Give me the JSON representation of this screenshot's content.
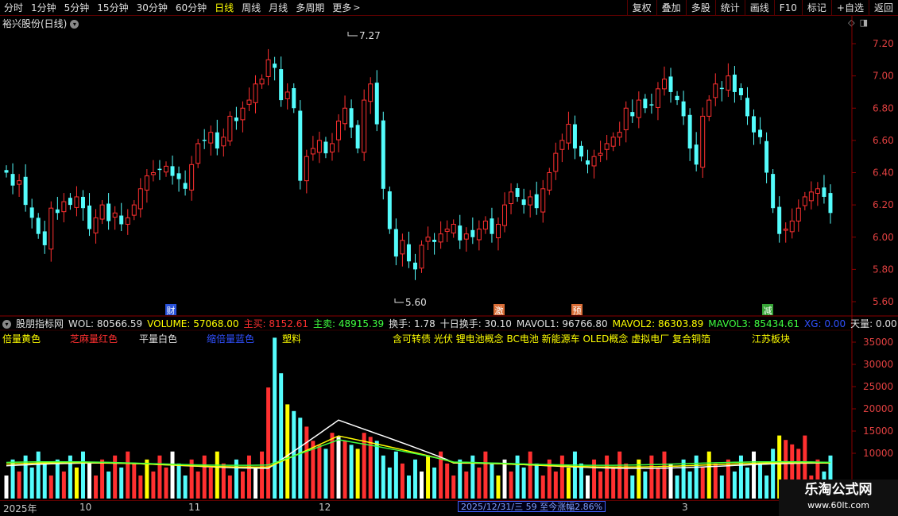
{
  "toolbar": {
    "periods": [
      {
        "label": "分时",
        "active": false
      },
      {
        "label": "1分钟",
        "active": false
      },
      {
        "label": "5分钟",
        "active": false
      },
      {
        "label": "15分钟",
        "active": false
      },
      {
        "label": "30分钟",
        "active": false
      },
      {
        "label": "60分钟",
        "active": false
      },
      {
        "label": "日线",
        "active": true
      },
      {
        "label": "周线",
        "active": false
      },
      {
        "label": "月线",
        "active": false
      },
      {
        "label": "多周期",
        "active": false
      },
      {
        "label": "更多",
        "active": false
      }
    ],
    "more_chevron": "chevron-right-icon",
    "right_buttons": [
      "复权",
      "叠加",
      "多股",
      "统计",
      "画线",
      "F10",
      "标记",
      "+自选",
      "返回"
    ]
  },
  "stock": {
    "title": "裕兴股份(日线)"
  },
  "price_axis": {
    "ticks": [
      "7.20",
      "7.00",
      "6.80",
      "6.60",
      "6.40",
      "6.20",
      "6.00",
      "5.80",
      "5.60"
    ],
    "high_label": "7.27",
    "low_label": "5.60"
  },
  "event_markers": [
    {
      "label": "财",
      "color": "#3060ff"
    },
    {
      "label": "激",
      "color": "#ff8040"
    },
    {
      "label": "预",
      "color": "#ff8040"
    },
    {
      "label": "减",
      "color": "#40c040"
    }
  ],
  "indicator": {
    "name": "股朋指标网",
    "values": [
      {
        "text": "WOL: 80566.59",
        "color": "#e0e0e0"
      },
      {
        "text": "VOLUME: 57068.00",
        "color": "#ffff00"
      },
      {
        "text": "主买: 8152.61",
        "color": "#ff3030"
      },
      {
        "text": "主卖: 48915.39",
        "color": "#40ff40"
      },
      {
        "text": "换手: 1.78",
        "color": "#e0e0e0"
      },
      {
        "text": "十日换手: 30.10",
        "color": "#e0e0e0"
      },
      {
        "text": "MAVOL1: 96766.80",
        "color": "#e0e0e0"
      },
      {
        "text": "MAVOL2: 86303.89",
        "color": "#ffff00"
      },
      {
        "text": "MAVOL3: 85434.61",
        "color": "#40ff40"
      },
      {
        "text": "XG: 0.00",
        "color": "#3050ff"
      },
      {
        "text": "天量: 0.00",
        "color": "#e0e0e0"
      }
    ],
    "legend_tags": [
      {
        "text": "倍量黄色",
        "color": "#ffff00"
      },
      {
        "text": "芝麻量红色",
        "color": "#ff3030"
      },
      {
        "text": "平量白色",
        "color": "#e0e0e0"
      },
      {
        "text": "缩倍量蓝色",
        "color": "#3050ff"
      },
      {
        "text": "塑料",
        "color": "#ffff00"
      },
      {
        "text": "含可转债 光伏 锂电池概念 BC电池 新能源车 OLED概念 虚拟电厂 复合铜箔",
        "color": "#ffff00"
      },
      {
        "text": "江苏板块",
        "color": "#ffff00"
      }
    ]
  },
  "volume_axis": {
    "ticks": [
      "35000",
      "30000",
      "25000",
      "20000",
      "15000",
      "10000"
    ]
  },
  "time_axis": {
    "labels": [
      "2025年",
      "10",
      "11",
      "12",
      "3"
    ]
  },
  "status_box": "2025/12/31/三 59 至今涨幅2.86%",
  "watermark": {
    "title": "乐淘公式网",
    "url": "www.60lt.com"
  },
  "colors": {
    "up": "#ff3030",
    "down": "#54fcfc",
    "grid_border": "#8a0000",
    "ma1": "#ffffff",
    "ma2": "#ffff00",
    "ma3": "#40ff40"
  }
}
